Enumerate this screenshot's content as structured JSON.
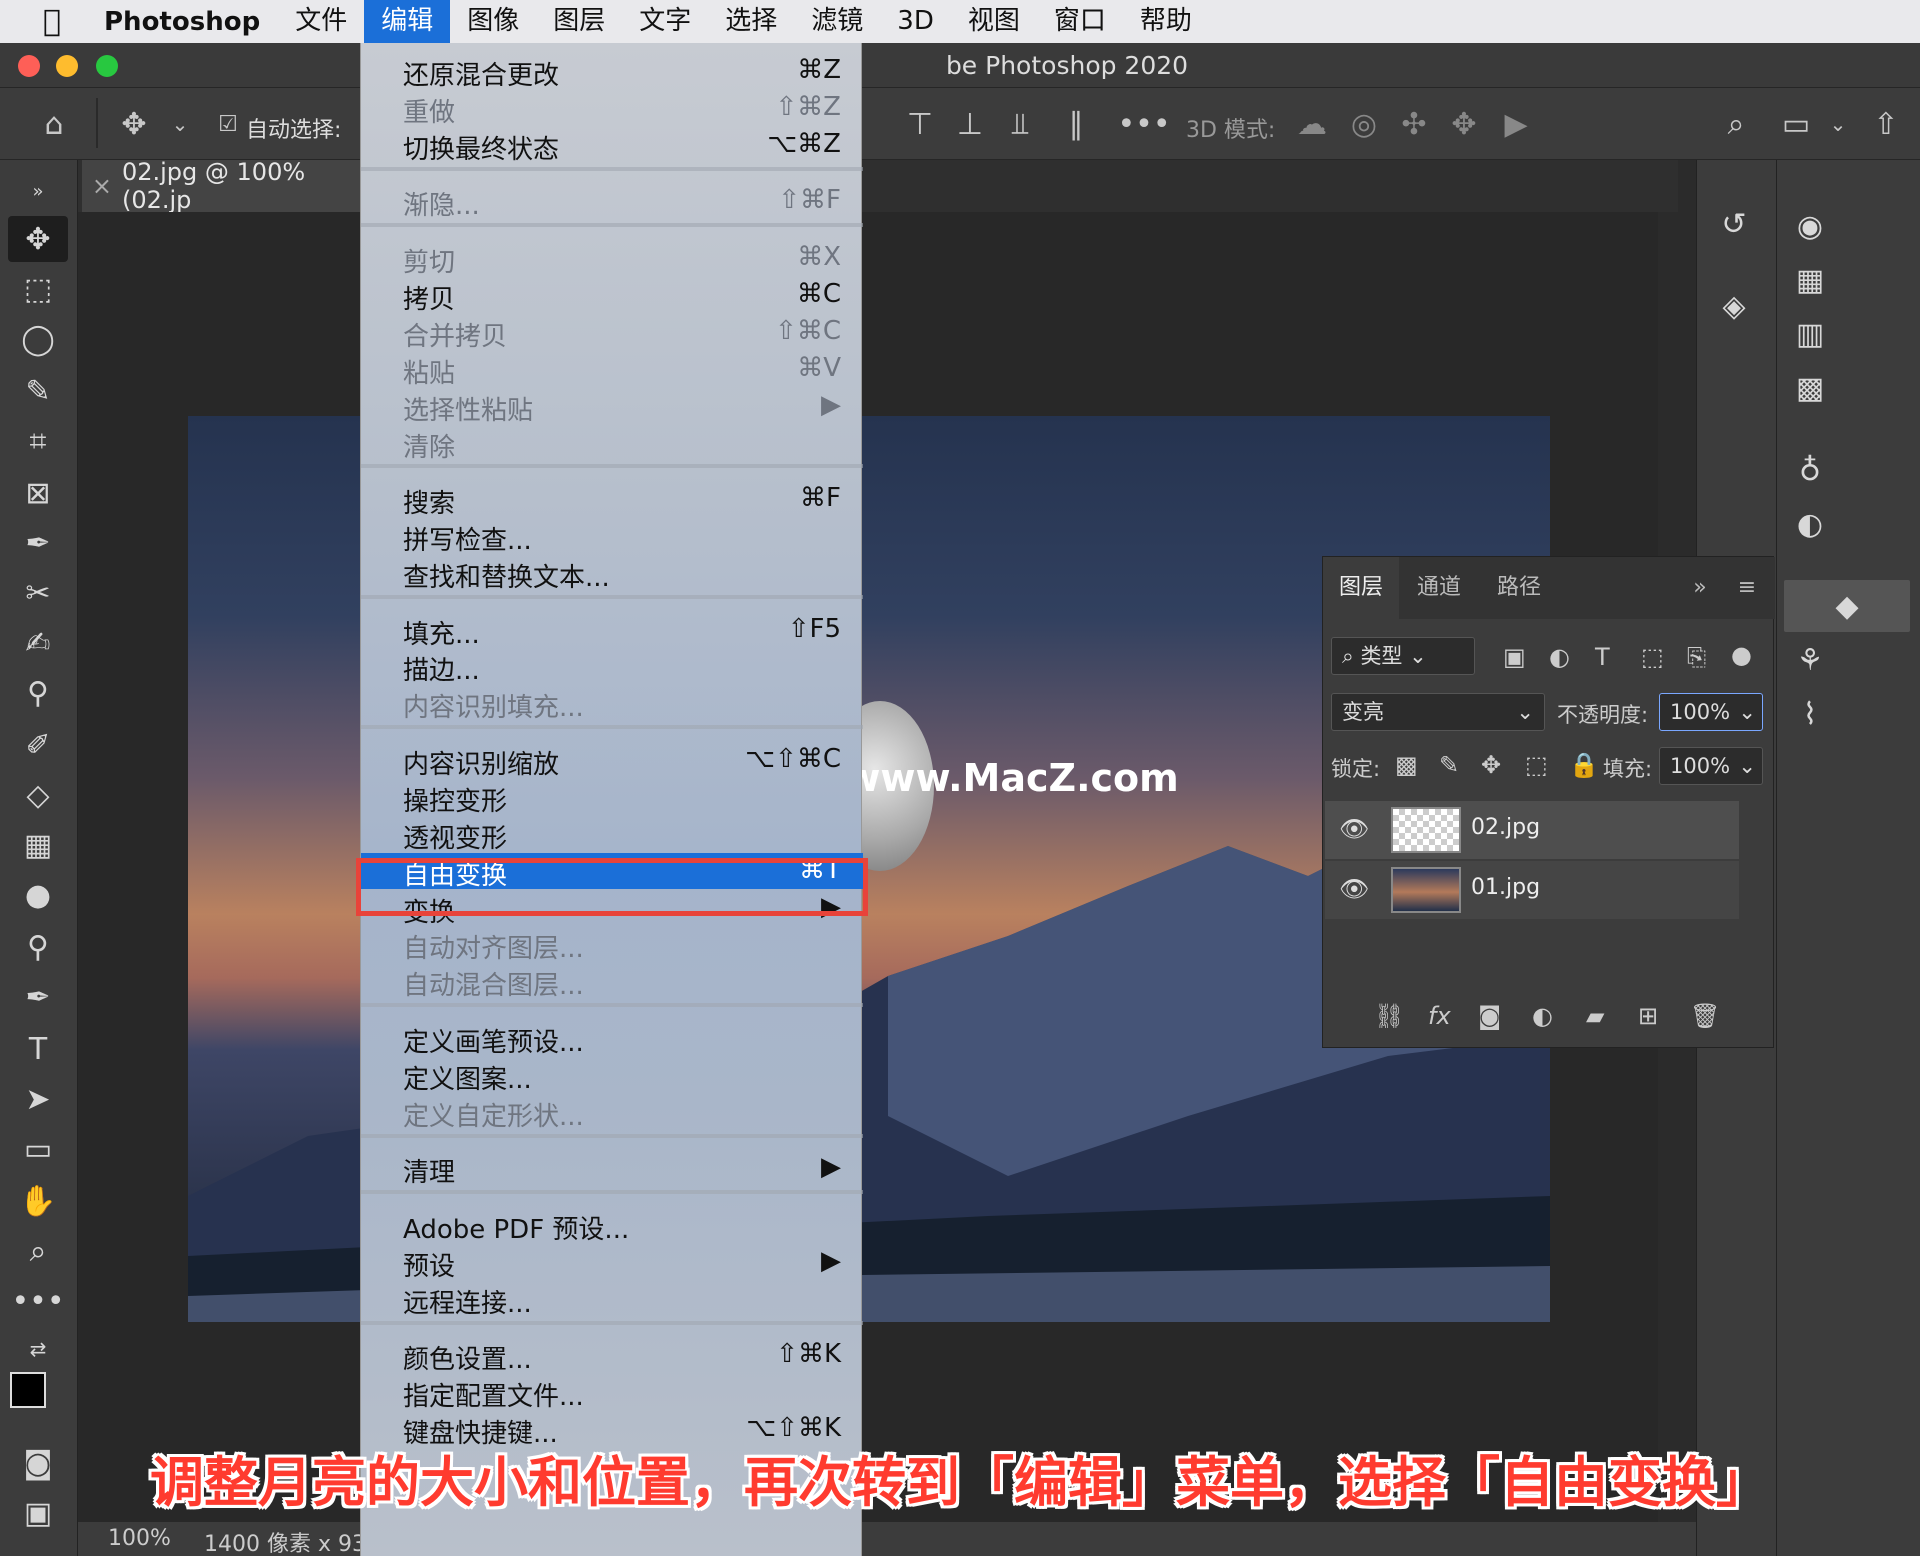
{
  "menubar": {
    "app": "Photoshop",
    "items": [
      "文件",
      "编辑",
      "图像",
      "图层",
      "文字",
      "选择",
      "滤镜",
      "3D",
      "视图",
      "窗口",
      "帮助"
    ],
    "active": "编辑"
  },
  "window": {
    "title": "be Photoshop 2020"
  },
  "options": {
    "auto_select": "自动选择:",
    "mode3d": "3D 模式:"
  },
  "document": {
    "tab": "02.jpg @ 100% (02.jp"
  },
  "edit_menu": {
    "groups": [
      [
        {
          "label": "还原混合更改",
          "shortcut": "⌘Z",
          "disabled": false
        },
        {
          "label": "重做",
          "shortcut": "⇧⌘Z",
          "disabled": true
        },
        {
          "label": "切换最终状态",
          "shortcut": "⌥⌘Z",
          "disabled": false
        }
      ],
      [
        {
          "label": "渐隐...",
          "shortcut": "⇧⌘F",
          "disabled": true
        }
      ],
      [
        {
          "label": "剪切",
          "shortcut": "⌘X",
          "disabled": true
        },
        {
          "label": "拷贝",
          "shortcut": "⌘C",
          "disabled": false
        },
        {
          "label": "合并拷贝",
          "shortcut": "⇧⌘C",
          "disabled": true
        },
        {
          "label": "粘贴",
          "shortcut": "⌘V",
          "disabled": true
        },
        {
          "label": "选择性粘贴",
          "shortcut": "▶",
          "disabled": true
        },
        {
          "label": "清除",
          "shortcut": "",
          "disabled": true
        }
      ],
      [
        {
          "label": "搜索",
          "shortcut": "⌘F",
          "disabled": false
        },
        {
          "label": "拼写检查...",
          "shortcut": "",
          "disabled": false
        },
        {
          "label": "查找和替换文本...",
          "shortcut": "",
          "disabled": false
        }
      ],
      [
        {
          "label": "填充...",
          "shortcut": "⇧F5",
          "disabled": false
        },
        {
          "label": "描边...",
          "shortcut": "",
          "disabled": false
        },
        {
          "label": "内容识别填充...",
          "shortcut": "",
          "disabled": true
        }
      ],
      [
        {
          "label": "内容识别缩放",
          "shortcut": "⌥⇧⌘C",
          "disabled": false
        },
        {
          "label": "操控变形",
          "shortcut": "",
          "disabled": false
        },
        {
          "label": "透视变形",
          "shortcut": "",
          "disabled": false
        },
        {
          "label": "自由变换",
          "shortcut": "⌘T",
          "disabled": false,
          "highlighted": true
        },
        {
          "label": "变换",
          "shortcut": "▶",
          "disabled": false
        },
        {
          "label": "自动对齐图层...",
          "shortcut": "",
          "disabled": true
        },
        {
          "label": "自动混合图层...",
          "shortcut": "",
          "disabled": true
        }
      ],
      [
        {
          "label": "定义画笔预设...",
          "shortcut": "",
          "disabled": false
        },
        {
          "label": "定义图案...",
          "shortcut": "",
          "disabled": false
        },
        {
          "label": "定义自定形状...",
          "shortcut": "",
          "disabled": true
        }
      ],
      [
        {
          "label": "清理",
          "shortcut": "▶",
          "disabled": false
        }
      ],
      [
        {
          "label": "Adobe PDF 预设...",
          "shortcut": "",
          "disabled": false
        },
        {
          "label": "预设",
          "shortcut": "▶",
          "disabled": false
        },
        {
          "label": "远程连接...",
          "shortcut": "",
          "disabled": false
        }
      ],
      [
        {
          "label": "颜色设置...",
          "shortcut": "⇧⌘K",
          "disabled": false
        },
        {
          "label": "指定配置文件...",
          "shortcut": "",
          "disabled": false
        },
        {
          "label": "键盘快捷键...",
          "shortcut": "⌥⇧⌘K",
          "disabled": false
        }
      ]
    ]
  },
  "layers_panel": {
    "tabs": [
      "图层",
      "通道",
      "路径"
    ],
    "filter": "类型",
    "blend_mode": "变亮",
    "opacity_label": "不透明度:",
    "opacity": "100%",
    "lock_label": "锁定:",
    "fill_label": "填充:",
    "fill": "100%",
    "layers": [
      {
        "name": "02.jpg",
        "selected": true
      },
      {
        "name": "01.jpg",
        "selected": false
      }
    ]
  },
  "status": {
    "zoom": "100%",
    "size": "1400 像素 x 93"
  },
  "watermark": {
    "z": "Z",
    "text": "www.MacZ.com"
  },
  "caption": "调整月亮的大小和位置，再次转到「编辑」菜单，选择「自由变换」",
  "colors": {
    "highlight": "#1b6fd8",
    "outline": "#e8433a",
    "caption": "#ff3b2f"
  }
}
